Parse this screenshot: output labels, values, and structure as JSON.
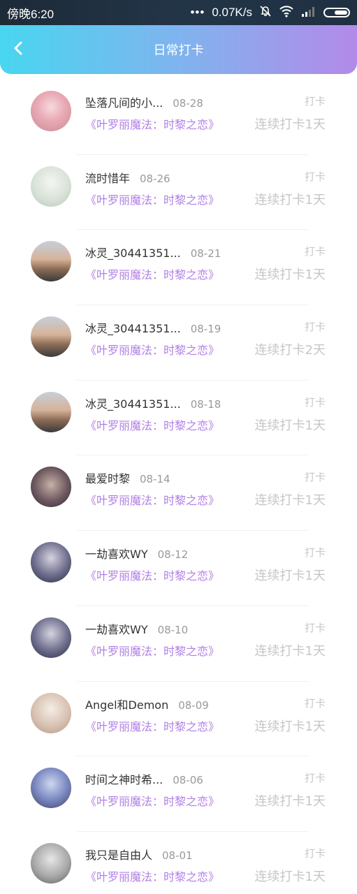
{
  "status_bar": {
    "time": "傍晚6:20",
    "dots": "•••",
    "speed": "0.07K/s",
    "icons": [
      "mute-bell-icon",
      "wifi-icon",
      "signal-icon",
      "battery-icon"
    ]
  },
  "header": {
    "back_icon": "chevron-left-icon",
    "title": "日常打卡"
  },
  "colors": {
    "header_gradient_start": "#48d6f0",
    "header_gradient_end": "#b38ae9",
    "game_title": "#b17fe6",
    "muted_text": "#c6c6c6"
  },
  "checkins": [
    {
      "name": "坠落凡间的小...",
      "date": "08-28",
      "game": "《叶罗丽魔法：时黎之恋》",
      "badge": "打卡",
      "streak": "连续打卡1天",
      "avatar": "anime1"
    },
    {
      "name": "流时惜年",
      "date": "08-26",
      "game": "《叶罗丽魔法：时黎之恋》",
      "badge": "打卡",
      "streak": "连续打卡1天",
      "avatar": "anime2"
    },
    {
      "name": "冰灵_30441351...",
      "date": "08-21",
      "game": "《叶罗丽魔法：时黎之恋》",
      "badge": "打卡",
      "streak": "连续打卡1天",
      "avatar": "city"
    },
    {
      "name": "冰灵_30441351...",
      "date": "08-19",
      "game": "《叶罗丽魔法：时黎之恋》",
      "badge": "打卡",
      "streak": "连续打卡2天",
      "avatar": "city"
    },
    {
      "name": "冰灵_30441351...",
      "date": "08-18",
      "game": "《叶罗丽魔法：时黎之恋》",
      "badge": "打卡",
      "streak": "连续打卡1天",
      "avatar": "city"
    },
    {
      "name": "最爱时黎",
      "date": "08-14",
      "game": "《叶罗丽魔法：时黎之恋》",
      "badge": "打卡",
      "streak": "连续打卡1天",
      "avatar": "girl"
    },
    {
      "name": "一劫喜欢WY",
      "date": "08-12",
      "game": "《叶罗丽魔法：时黎之恋》",
      "badge": "打卡",
      "streak": "连续打卡1天",
      "avatar": "person"
    },
    {
      "name": "一劫喜欢WY",
      "date": "08-10",
      "game": "《叶罗丽魔法：时黎之恋》",
      "badge": "打卡",
      "streak": "连续打卡1天",
      "avatar": "person"
    },
    {
      "name": "Angel和Demon",
      "date": "08-09",
      "game": "《叶罗丽魔法：时黎之恋》",
      "badge": "打卡",
      "streak": "连续打卡1天",
      "avatar": "angel"
    },
    {
      "name": "时间之神时希...",
      "date": "08-06",
      "game": "《叶罗丽魔法：时黎之恋》",
      "badge": "打卡",
      "streak": "连续打卡1天",
      "avatar": "fantasy"
    },
    {
      "name": "我只是自由人",
      "date": "08-01",
      "game": "《叶罗丽魔法：时黎之恋》",
      "badge": "打卡",
      "streak": "连续打卡1天",
      "avatar": "boy"
    }
  ]
}
